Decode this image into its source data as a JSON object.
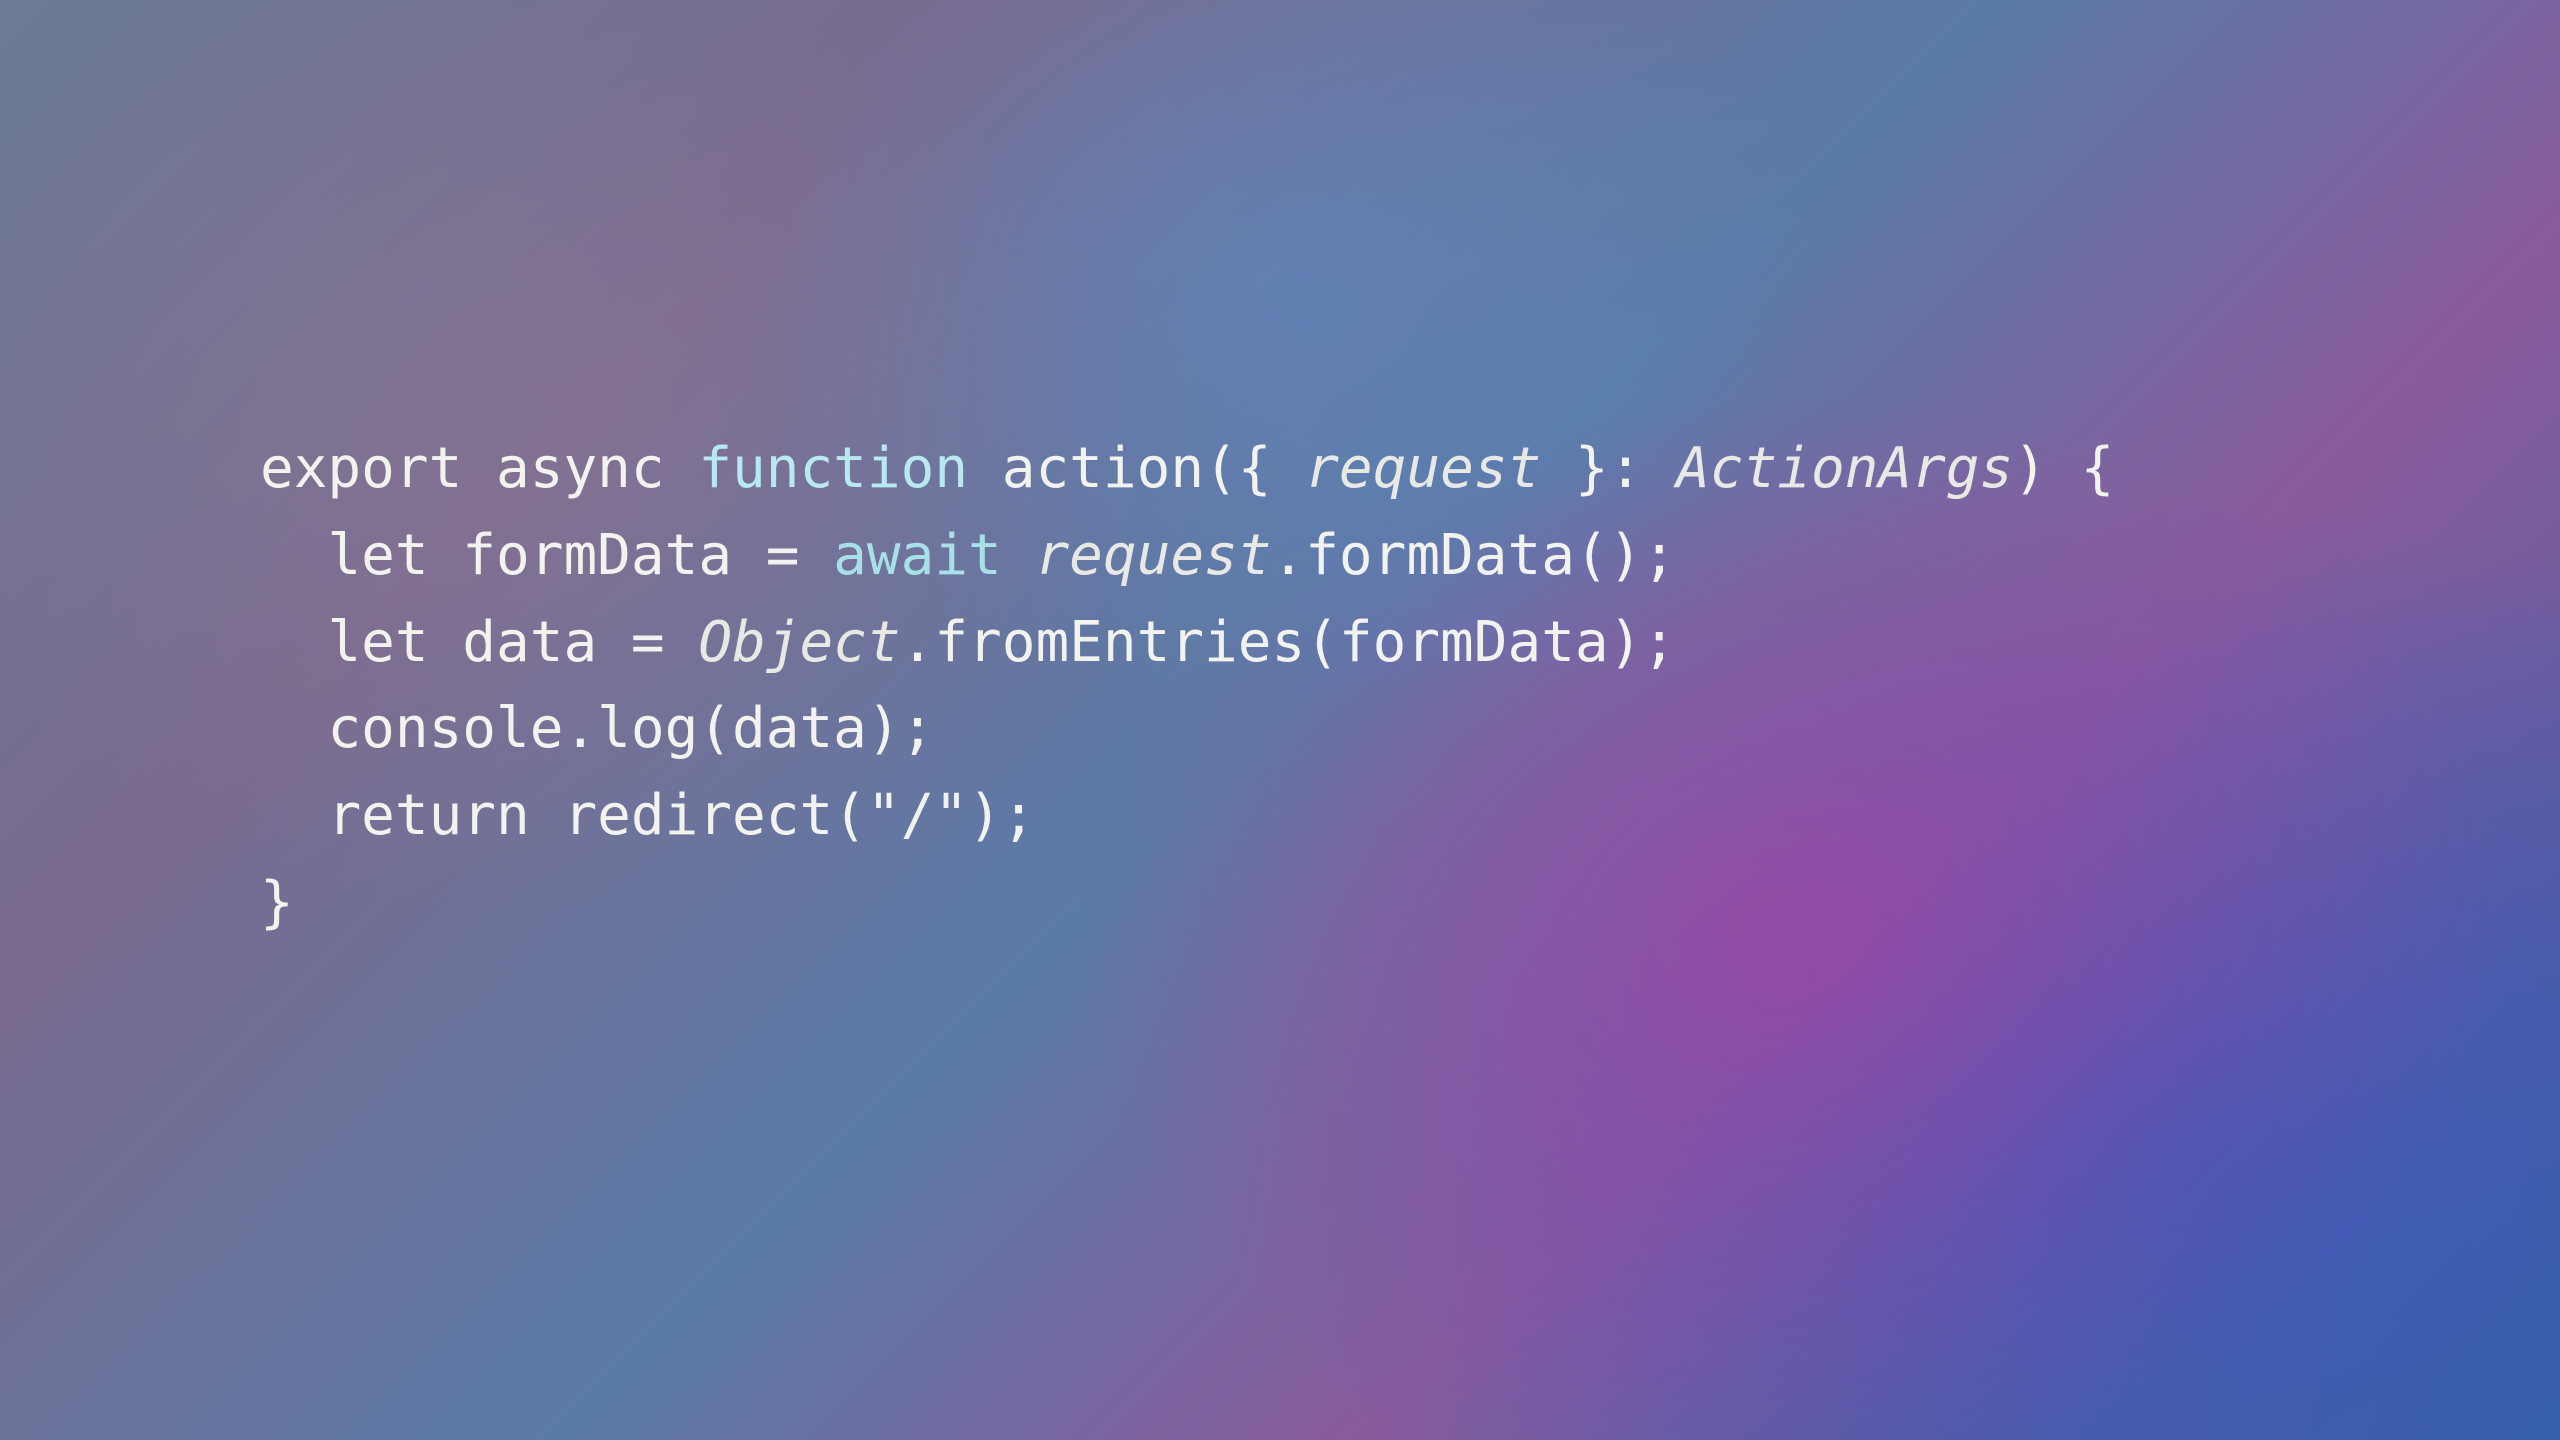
{
  "code": {
    "lines": [
      {
        "indent": 0,
        "tokens": [
          {
            "t": "export",
            "c": "kw"
          },
          {
            "t": " ",
            "c": "pn"
          },
          {
            "t": "async",
            "c": "kw"
          },
          {
            "t": " ",
            "c": "pn"
          },
          {
            "t": "function",
            "c": "fn"
          },
          {
            "t": " ",
            "c": "pn"
          },
          {
            "t": "action",
            "c": "pn"
          },
          {
            "t": "({ ",
            "c": "pn"
          },
          {
            "t": "request",
            "c": "it"
          },
          {
            "t": " }: ",
            "c": "pn"
          },
          {
            "t": "ActionArgs",
            "c": "it"
          },
          {
            "t": ") {",
            "c": "pn"
          }
        ]
      },
      {
        "indent": 1,
        "tokens": [
          {
            "t": "let",
            "c": "kw"
          },
          {
            "t": " formData = ",
            "c": "pn"
          },
          {
            "t": "await",
            "c": "aw"
          },
          {
            "t": " ",
            "c": "pn"
          },
          {
            "t": "request",
            "c": "it"
          },
          {
            "t": ".formData();",
            "c": "pn"
          }
        ]
      },
      {
        "indent": 1,
        "tokens": [
          {
            "t": "let",
            "c": "kw"
          },
          {
            "t": " data = ",
            "c": "pn"
          },
          {
            "t": "Object",
            "c": "it"
          },
          {
            "t": ".fromEntries(formData);",
            "c": "pn"
          }
        ]
      },
      {
        "indent": 1,
        "tokens": [
          {
            "t": "console.log(data);",
            "c": "pn"
          }
        ]
      },
      {
        "indent": 0,
        "tokens": [
          {
            "t": "",
            "c": "pn"
          }
        ]
      },
      {
        "indent": 1,
        "tokens": [
          {
            "t": "return",
            "c": "kw"
          },
          {
            "t": " redirect(",
            "c": "pn"
          },
          {
            "t": "\"/\"",
            "c": "str"
          },
          {
            "t": ");",
            "c": "pn"
          }
        ]
      },
      {
        "indent": 0,
        "tokens": [
          {
            "t": "}",
            "c": "pn"
          }
        ]
      }
    ]
  }
}
